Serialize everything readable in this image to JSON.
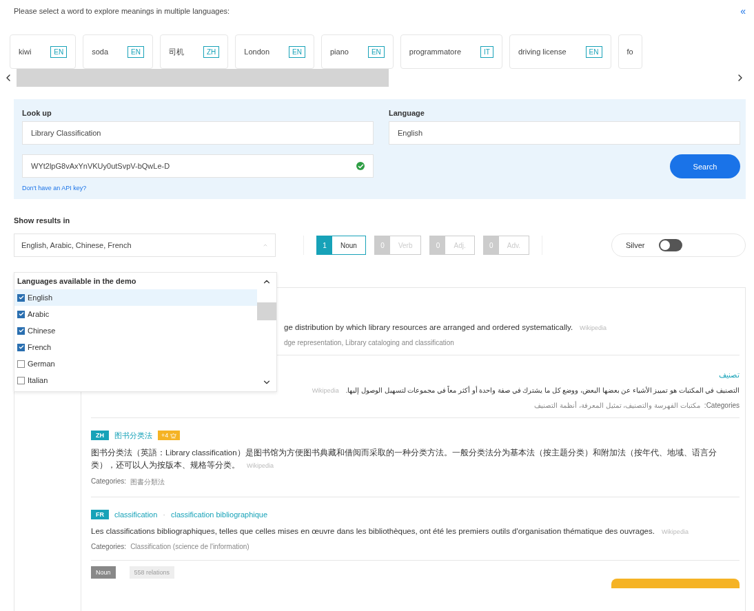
{
  "prompt": "Please select a word to explore meanings in multiple languages:",
  "collapse": "«",
  "words": [
    {
      "word": "kiwi",
      "lang": "EN"
    },
    {
      "word": "soda",
      "lang": "EN"
    },
    {
      "word": "司机",
      "lang": "ZH"
    },
    {
      "word": "London",
      "lang": "EN"
    },
    {
      "word": "piano",
      "lang": "EN"
    },
    {
      "word": "programmatore",
      "lang": "IT"
    },
    {
      "word": "driving license",
      "lang": "EN"
    },
    {
      "word": "fo"
    }
  ],
  "lookup": {
    "label": "Look up",
    "value": "Library Classification",
    "api_key": "WYt2lpG8vAxYnVKUy0utSvpV-bQwLe-D",
    "api_key_valid": true,
    "api_link": "Don't have an API key?"
  },
  "language": {
    "label": "Language",
    "value": "English"
  },
  "search_button": "Search",
  "results_in": {
    "label": "Show results in",
    "value": "English, Arabic, Chinese, French",
    "dropdown": {
      "header": "Languages available in the demo",
      "options": [
        {
          "label": "English",
          "checked": true,
          "selected": true
        },
        {
          "label": "Arabic",
          "checked": true,
          "selected": false
        },
        {
          "label": "Chinese",
          "checked": true,
          "selected": false
        },
        {
          "label": "French",
          "checked": true,
          "selected": false
        },
        {
          "label": "German",
          "checked": false,
          "selected": false
        },
        {
          "label": "Italian",
          "checked": false,
          "selected": false
        }
      ]
    }
  },
  "pos_filters": [
    {
      "count": "1",
      "label": "Noun",
      "selected": true
    },
    {
      "count": "0",
      "label": "Verb",
      "selected": false
    },
    {
      "count": "0",
      "label": "Adj.",
      "selected": false
    },
    {
      "count": "0",
      "label": "Adv.",
      "selected": false
    }
  ],
  "silver": {
    "label": "Silver",
    "on": false
  },
  "senses": [
    {
      "kind": "partial",
      "text": "ge distribution by which library resources are arranged and ordered systematically.",
      "source": "Wikipedia",
      "categories": "dge representation, Library cataloging and classification"
    },
    {
      "kind": "rtl",
      "titles": [
        "تصنيف"
      ],
      "text": "التصنيف في المكتبات هو تمييز الأشياء عن بعضها البعض، ووضع كل ما يشترك في صفة واحدة أو أكثر معاً في مجموعات لتسهيل الوصول إليها.",
      "source": "Wikipedia",
      "categories_label": "Categories:",
      "categories": "مكتبات الفهرسة والتصنيف، تمثيل المعرفة، أنظمة التصنيف"
    },
    {
      "kind": "full",
      "lang": "ZH",
      "titles": [
        "图书分类法"
      ],
      "extra": "+4",
      "text": "图书分类法（英語：Library classification）是图书馆为方便图书典藏和借阅而采取的一种分类方法。一般分类法分为基本法（按主题分类）和附加法（按年代、地域、语言分类），还可以人为按版本、规格等分类。",
      "source": "Wikipedia",
      "categories_label": "Categories:",
      "categories": "图書分類法"
    },
    {
      "kind": "full",
      "lang": "FR",
      "titles": [
        "classification",
        "classification bibliographique"
      ],
      "separator": "·",
      "text": "Les classifications bibliographiques, telles que celles mises en œuvre dans les bibliothèques, ont été les premiers outils d'organisation thématique des ouvrages.",
      "source": "Wikipedia",
      "categories_label": "Categories:",
      "categories": "Classification (science de l'information)"
    }
  ],
  "footer": {
    "pos": "Noun",
    "relations": "558 relations"
  }
}
